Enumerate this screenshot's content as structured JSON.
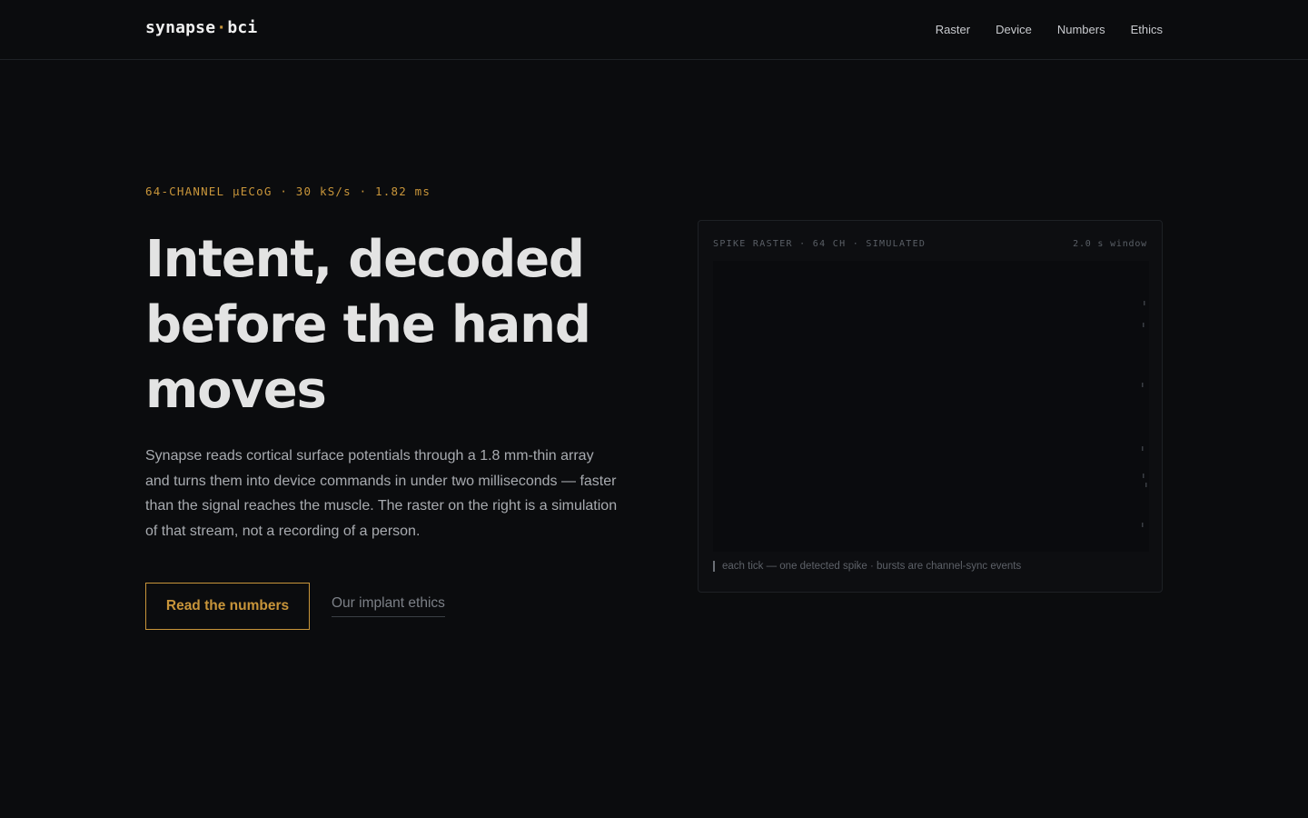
{
  "header": {
    "logo_left": "synapse",
    "logo_dot": "·",
    "logo_right": "bci",
    "nav": [
      "Raster",
      "Device",
      "Numbers",
      "Ethics"
    ]
  },
  "hero": {
    "eyebrow": "64-CHANNEL µECoG · 30 kS/s · 1.82 ms",
    "headline": "Intent, decoded before the hand moves",
    "lede": "Synapse reads cortical surface potentials through a 1.8 mm-thin array and turns them into device commands in under two milliseconds — faster than the signal reaches the muscle. The raster on the right is a simulation of that stream, not a recording of a person.",
    "primary_cta": "Read the numbers",
    "secondary_cta": "Our implant ethics"
  },
  "raster_panel": {
    "label": "SPIKE RASTER · 64 CH · SIMULATED",
    "window": "2.0 s window",
    "legend": "each tick — one detected spike · bursts are channel-sync events",
    "accent_color": "#c8953a",
    "tick_color": "#3a3e44"
  }
}
